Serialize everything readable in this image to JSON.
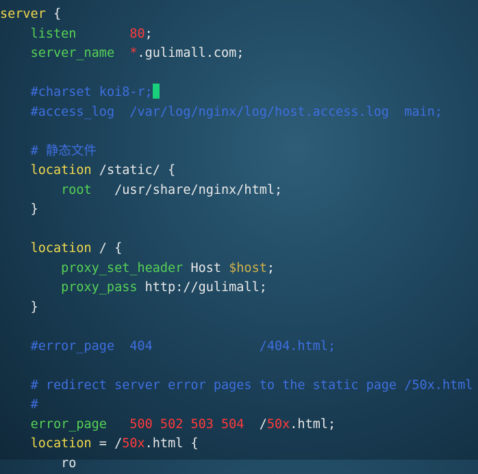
{
  "editor": {
    "l1": {
      "kw": "server",
      "rest": " {"
    },
    "l2": {
      "indent": "    ",
      "dir": "listen",
      "pad": "       ",
      "num": "80",
      "end": ";"
    },
    "l3": {
      "indent": "    ",
      "dir": "server_name",
      "pad": "  ",
      "star": "*",
      "host": ".gulimall.com;"
    },
    "l5": {
      "indent": "    ",
      "cmt": "#charset koi8-r;"
    },
    "l6": {
      "indent": "    ",
      "cmt": "#access_log  /var/log/nginx/log/host.access.log  main;"
    },
    "l8": {
      "indent": "    ",
      "cmt": "# 静态文件"
    },
    "l9": {
      "indent": "    ",
      "kw": "location",
      "rest": " /static/ {"
    },
    "l10": {
      "indent": "        ",
      "dir": "root",
      "rest": "   /usr/share/nginx/html;"
    },
    "l11": {
      "indent": "    ",
      "rest": "}"
    },
    "l13": {
      "indent": "    ",
      "kw": "location",
      "rest": " / {"
    },
    "l14": {
      "indent": "        ",
      "dir": "proxy_set_header",
      "mid": " Host ",
      "var": "$host",
      "end": ";"
    },
    "l15": {
      "indent": "        ",
      "dir": "proxy_pass",
      "rest": " http://gulimall;"
    },
    "l16": {
      "indent": "    ",
      "rest": "}"
    },
    "l18": {
      "indent": "    ",
      "cmt": "#error_page  404              /404.html;"
    },
    "l20": {
      "indent": "    ",
      "cmt": "# redirect server error pages to the static page /50x.html"
    },
    "l21": {
      "indent": "    ",
      "cmt": "#"
    },
    "l22": {
      "indent": "    ",
      "dir": "error_page",
      "pad": "   ",
      "nums": "500 502 503 504",
      "mid": "  /",
      "num": "50x",
      "end": ".html;"
    },
    "l23": {
      "indent": "    ",
      "kw": "location",
      "mid": " = /",
      "num": "50x",
      "end": ".html {"
    },
    "l24": {
      "indent": "    ",
      "partial": "    ro"
    }
  }
}
